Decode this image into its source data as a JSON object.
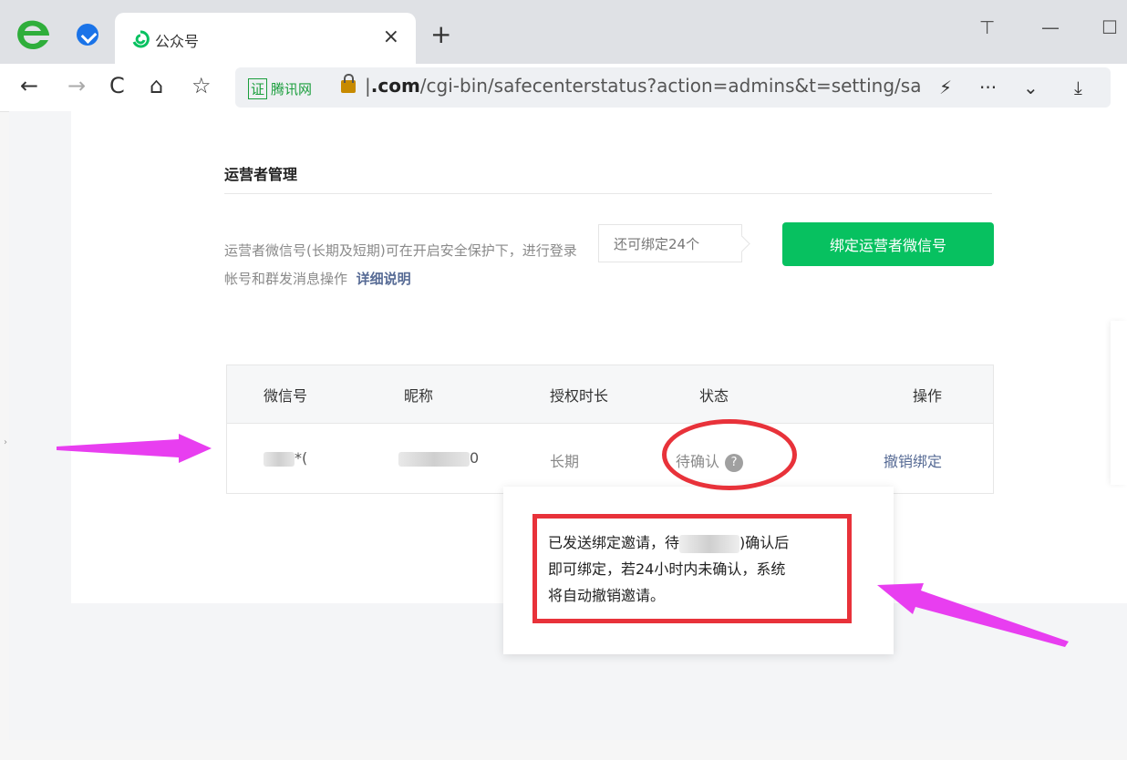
{
  "browser": {
    "tab_title": "公众号",
    "tab_close": "×",
    "new_tab": "+",
    "window_buttons": [
      "⊤",
      "—",
      "☐"
    ],
    "nav": {
      "back": "←",
      "forward": "→",
      "reload": "C",
      "home": "⌂",
      "favorite": "☆"
    },
    "cert_box": "证",
    "cert_label": "腾讯网",
    "url_domain": ".com",
    "url_path": "/cgi-bin/safecenterstatus?action=admins&t=setting/saf",
    "url_prefix": "|",
    "addr_actions": [
      "⚡",
      "···",
      "⌄"
    ],
    "download": "⤓"
  },
  "page": {
    "section_title": "运营者管理",
    "description": "运营者微信号(长期及短期)可在开启安全保护下，进行登录帐号和群发消息操作",
    "description_link": "详细说明",
    "remaining_bubble": "还可绑定24个",
    "bind_button": "绑定运营者微信号",
    "table": {
      "headers": [
        "微信号",
        "昵称",
        "授权时长",
        "状态",
        "操作"
      ],
      "row": {
        "wechat_suffix": "*(",
        "nickname_suffix": "0",
        "duration": "长期",
        "status": "待确认",
        "status_help": "?",
        "action": "撤销绑定"
      }
    },
    "popover": {
      "line1_pre": "已发送绑定邀请，待",
      "line1_post": ")确认后",
      "line2": "即可绑定，若24小时内未确认，系统",
      "line3": "将自动撤销邀请。"
    }
  },
  "colors": {
    "accent_green": "#07c160",
    "annotation_red": "#e8323a",
    "annotation_magenta": "#e83ef0",
    "link": "#576b95"
  },
  "icons": [
    "browser-logo-icon",
    "extension-icon",
    "tab-favicon-icon",
    "back-icon",
    "forward-icon",
    "reload-icon",
    "home-icon",
    "favorite-icon",
    "lock-icon",
    "bolt-icon",
    "more-icon",
    "chevron-down-icon",
    "download-icon",
    "help-icon"
  ]
}
